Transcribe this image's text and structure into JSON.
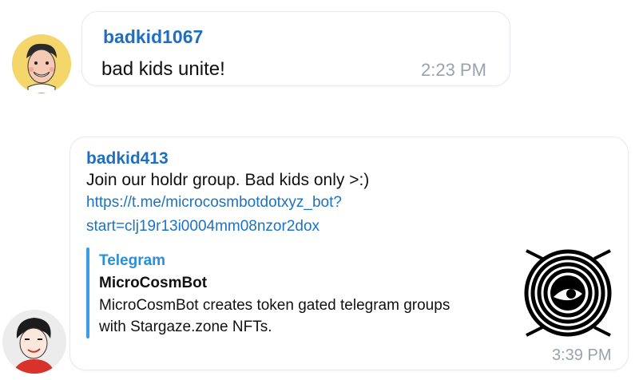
{
  "messages": [
    {
      "sender": "badkid1067",
      "text": "bad kids unite!",
      "time": "2:23 PM"
    },
    {
      "sender": "badkid413",
      "text": "Join our holdr group. Bad kids only >:)",
      "link_line1": "https://t.me/microcosmbotdotxyz_bot?",
      "link_line2": "start=clj19r13i0004mm08nzor2dox",
      "preview": {
        "site": "Telegram",
        "title": "MicroCosmBot",
        "desc_line1": "MicroCosmBot creates token gated telegram groups",
        "desc_line2": "with Stargaze.zone NFTs."
      },
      "time": "3:39 PM"
    }
  ],
  "colors": {
    "sender": "#1f6fc1",
    "link": "#1a73c4",
    "preview_accent": "#3a9ee8",
    "time": "#9aa3ad",
    "avatar1_bg": "#f5d66b"
  },
  "icons": {
    "avatar1": "cartoon-face-avatar-icon",
    "avatar2": "cartoon-boy-avatar-icon",
    "thumbnail": "spiral-eye-logo-icon"
  }
}
